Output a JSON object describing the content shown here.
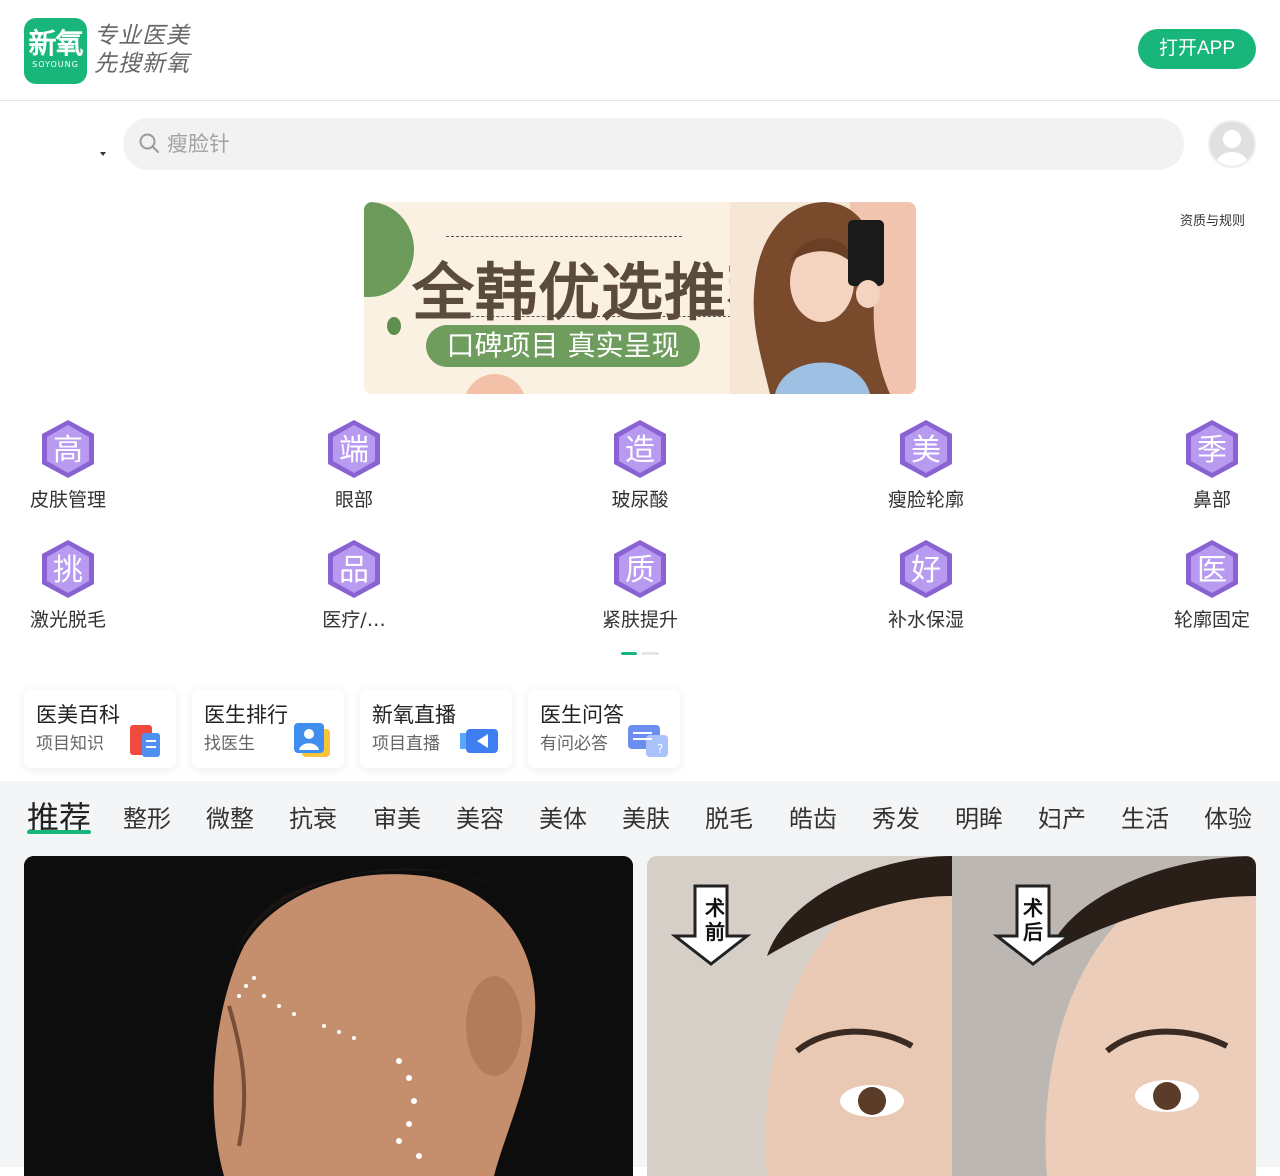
{
  "header": {
    "logo_main": "新氧",
    "logo_sub": "SOYOUNG",
    "slogan_line1": "专业医美",
    "slogan_line2": "先搜新氧",
    "open_app_label": "打开APP"
  },
  "search": {
    "placeholder": "瘦脸针"
  },
  "banner": {
    "title": "全韩优选推荐",
    "subtitle": "口碑项目 真实呈现"
  },
  "qualification_link": "资质与规则",
  "grid": [
    {
      "badge": "高",
      "label": "皮肤管理"
    },
    {
      "badge": "端",
      "label": "眼部"
    },
    {
      "badge": "造",
      "label": "玻尿酸"
    },
    {
      "badge": "美",
      "label": "瘦脸轮廓"
    },
    {
      "badge": "季",
      "label": "鼻部"
    },
    {
      "badge": "挑",
      "label": "激光脱毛"
    },
    {
      "badge": "品",
      "label": "医疗/…"
    },
    {
      "badge": "质",
      "label": "紧肤提升"
    },
    {
      "badge": "好",
      "label": "补水保湿"
    },
    {
      "badge": "医",
      "label": "轮廓固定"
    }
  ],
  "pager": {
    "active_index": 0,
    "count": 2
  },
  "quick_cards": [
    {
      "title": "医美百科",
      "sub": "项目知识",
      "icon": "document-icon"
    },
    {
      "title": "医生排行",
      "sub": "找医生",
      "icon": "doctor-icon"
    },
    {
      "title": "新氧直播",
      "sub": "项目直播",
      "icon": "video-icon"
    },
    {
      "title": "医生问答",
      "sub": "有问必答",
      "icon": "qa-icon"
    }
  ],
  "tabs": [
    "推荐",
    "整形",
    "微整",
    "抗衰",
    "审美",
    "美容",
    "美体",
    "美肤",
    "脱毛",
    "皓齿",
    "秀发",
    "明眸",
    "妇产",
    "生活",
    "体验"
  ],
  "before_after": {
    "before": "术前",
    "after": "术后"
  },
  "colors": {
    "brand": "#19b67c",
    "hex_badge": "#8a63d2"
  }
}
